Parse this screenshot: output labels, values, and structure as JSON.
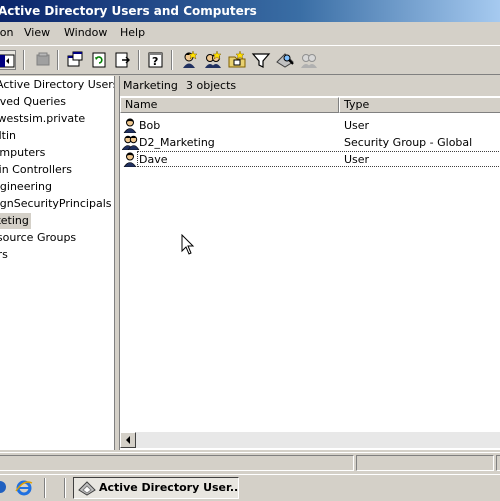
{
  "window": {
    "title": "Active Directory Users and Computers"
  },
  "menu": [
    "Action",
    "View",
    "Window",
    "Help"
  ],
  "toolbar": {
    "icons": [
      "back-icon",
      "forward-icon",
      "up-icon",
      "show-hide-tree-icon",
      "delete-icon",
      "properties-icon",
      "refresh-icon",
      "export-list-icon",
      "help-icon",
      "new-user-icon",
      "new-group-icon",
      "new-ou-icon",
      "filter-icon",
      "find-icon",
      "add-to-group-icon"
    ]
  },
  "tree": {
    "items": [
      {
        "label": "Active Directory Users and Computers",
        "selected": false
      },
      {
        "label": "Saved Queries",
        "selected": false
      },
      {
        "label": "westsim.private",
        "selected": false
      },
      {
        "label": "Builtin",
        "selected": false
      },
      {
        "label": "Computers",
        "selected": false
      },
      {
        "label": "Domain Controllers",
        "selected": false
      },
      {
        "label": "Engineering",
        "selected": false
      },
      {
        "label": "ForeignSecurityPrincipals",
        "selected": false
      },
      {
        "label": "Marketing",
        "selected": true
      },
      {
        "label": "Resource Groups",
        "selected": false
      },
      {
        "label": "Users",
        "selected": false
      }
    ]
  },
  "list": {
    "container": "Marketing",
    "count": "3 objects",
    "columns": [
      "Name",
      "Type"
    ],
    "rows": [
      {
        "name": "Bob",
        "type": "User",
        "icon": "user-icon"
      },
      {
        "name": "D2_Marketing",
        "type": "Security Group - Global",
        "icon": "group-icon"
      },
      {
        "name": "Dave",
        "type": "User",
        "icon": "user-icon"
      }
    ]
  },
  "taskbar": {
    "active_window": "Active Directory User..."
  },
  "colors": {
    "titlebar_start": "#0a246a",
    "titlebar_end": "#a6caf0",
    "face": "#d4d0c8"
  }
}
